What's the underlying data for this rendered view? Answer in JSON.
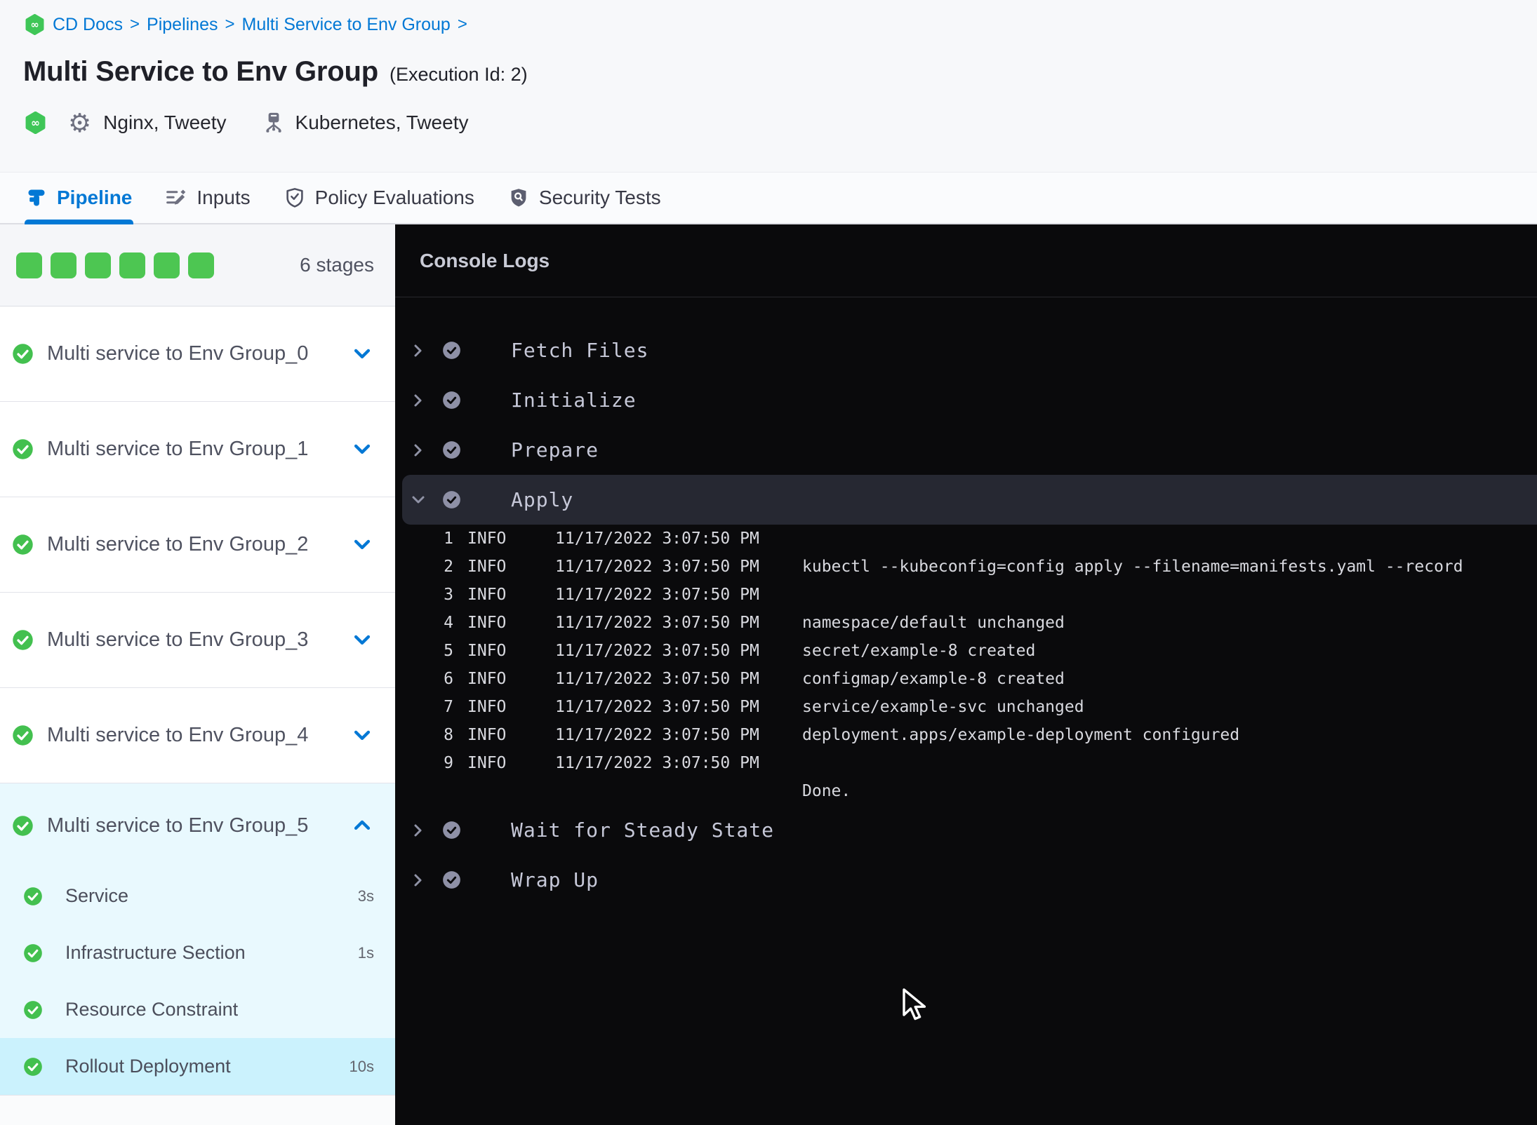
{
  "colors": {
    "accent_blue": "#0278D5",
    "success_green": "#4DC652",
    "console_background": "#0A0A0C",
    "expanded_stage_background": "#E9F9FE",
    "selected_step_background": "#CBF2FD",
    "expanded_console_step_background": "#262832"
  },
  "breadcrumb": {
    "items": [
      {
        "label": "CD Docs",
        "separator": ">"
      },
      {
        "label": "Pipelines",
        "separator": ">"
      },
      {
        "label": "Multi Service to Env Group",
        "separator": ">"
      }
    ]
  },
  "header": {
    "title": "Multi Service to Env Group",
    "execution_id": "(Execution Id: 2)",
    "services_label": "Nginx, Tweety",
    "environments_label": "Kubernetes, Tweety"
  },
  "tabs": [
    {
      "label": "Pipeline",
      "icon": "pipeline-icon",
      "active": true
    },
    {
      "label": "Inputs",
      "icon": "inputs-icon"
    },
    {
      "label": "Policy Evaluations",
      "icon": "policy-icon"
    },
    {
      "label": "Security Tests",
      "icon": "security-icon"
    }
  ],
  "sidebar": {
    "stage_count_label": "6 stages",
    "progress_squares": [
      {
        "status": "success"
      },
      {
        "status": "success"
      },
      {
        "status": "success"
      },
      {
        "status": "success"
      },
      {
        "status": "success"
      },
      {
        "status": "success"
      }
    ],
    "stages": [
      {
        "name": "Multi service to Env Group_0"
      },
      {
        "name": "Multi service to Env Group_1"
      },
      {
        "name": "Multi service to Env Group_2"
      },
      {
        "name": "Multi service to Env Group_3"
      },
      {
        "name": "Multi service to Env Group_4"
      },
      {
        "name": "Multi service to Env Group_5",
        "expanded": true,
        "steps": [
          {
            "name": "Service",
            "duration": "3s"
          },
          {
            "name": "Infrastructure Section",
            "duration": "1s"
          },
          {
            "name": "Resource Constraint",
            "duration": ""
          },
          {
            "name": "Rollout Deployment",
            "duration": "10s",
            "selected": true
          }
        ]
      }
    ]
  },
  "console": {
    "title": "Console Logs",
    "steps": [
      {
        "name": "Fetch Files"
      },
      {
        "name": "Initialize"
      },
      {
        "name": "Prepare"
      },
      {
        "name": "Apply",
        "expanded": true,
        "logs": [
          {
            "num": "1",
            "level": "INFO",
            "time": "11/17/2022 3:07:50 PM",
            "msg": ""
          },
          {
            "num": "2",
            "level": "INFO",
            "time": "11/17/2022 3:07:50 PM",
            "msg": "kubectl --kubeconfig=config apply --filename=manifests.yaml --record"
          },
          {
            "num": "3",
            "level": "INFO",
            "time": "11/17/2022 3:07:50 PM",
            "msg": ""
          },
          {
            "num": "4",
            "level": "INFO",
            "time": "11/17/2022 3:07:50 PM",
            "msg": "namespace/default unchanged"
          },
          {
            "num": "5",
            "level": "INFO",
            "time": "11/17/2022 3:07:50 PM",
            "msg": "secret/example-8 created"
          },
          {
            "num": "6",
            "level": "INFO",
            "time": "11/17/2022 3:07:50 PM",
            "msg": "configmap/example-8 created"
          },
          {
            "num": "7",
            "level": "INFO",
            "time": "11/17/2022 3:07:50 PM",
            "msg": "service/example-svc unchanged"
          },
          {
            "num": "8",
            "level": "INFO",
            "time": "11/17/2022 3:07:50 PM",
            "msg": "deployment.apps/example-deployment configured"
          },
          {
            "num": "9",
            "level": "INFO",
            "time": "11/17/2022 3:07:50 PM",
            "msg": ""
          },
          {
            "num": "",
            "level": "",
            "time": "",
            "msg": "Done."
          }
        ]
      },
      {
        "name": "Wait for Steady State"
      },
      {
        "name": "Wrap Up"
      }
    ]
  }
}
